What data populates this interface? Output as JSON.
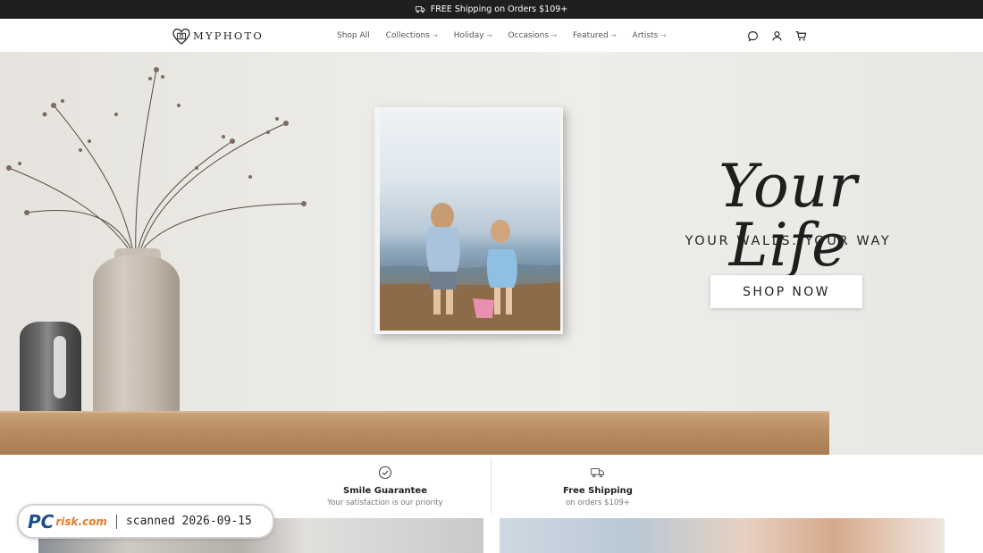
{
  "promo": {
    "text": "FREE Shipping on Orders $109+",
    "icon": "truck-icon"
  },
  "nav": {
    "logo_text": "MYPHOTO",
    "menu": [
      {
        "label": "Shop All",
        "arrow": ""
      },
      {
        "label": "Collections",
        "arrow": "→"
      },
      {
        "label": "Holiday",
        "arrow": "→"
      },
      {
        "label": "Occasions",
        "arrow": "→"
      },
      {
        "label": "Featured",
        "arrow": "→"
      },
      {
        "label": "Artists",
        "arrow": "→"
      }
    ],
    "icons": [
      "chat-icon",
      "user-icon",
      "cart-icon"
    ]
  },
  "hero": {
    "title": "Your Life",
    "subtitle": "YOUR WALLS.  YOUR WAY",
    "cta_label": "SHOP NOW"
  },
  "features": [
    {
      "title": "Smile Guarantee",
      "subtitle": "Your satisfaction is our priority",
      "icon": "check-circle-icon"
    },
    {
      "title": "Free Shipping",
      "subtitle": "on orders $109+",
      "icon": "truck-icon"
    }
  ],
  "watermark": {
    "logo_pc": "PC",
    "logo_rest": "risk.com",
    "scan_text": "scanned 2026-09-15"
  },
  "colors": {
    "topbar": "#1f1f1f",
    "cta_bg": "#ffffff",
    "text": "#222222"
  }
}
